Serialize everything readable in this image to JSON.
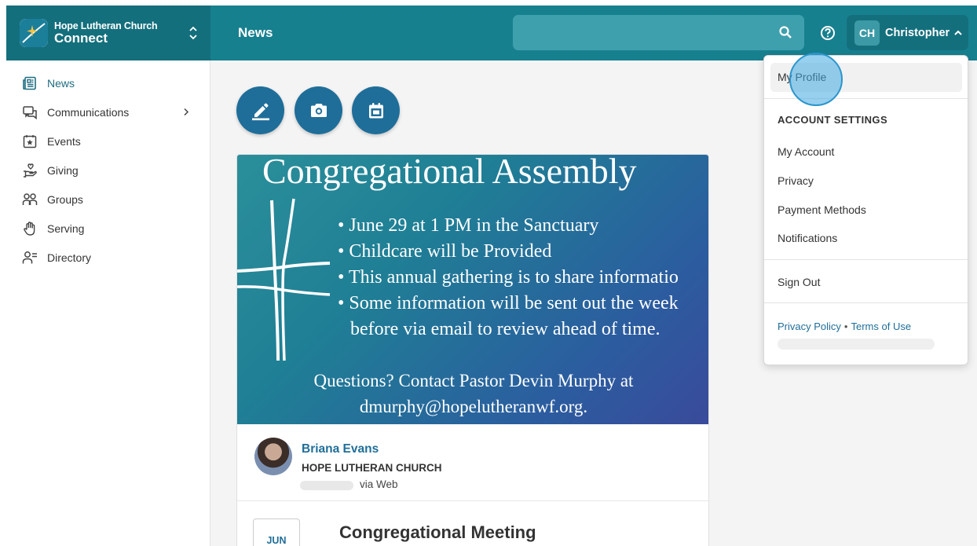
{
  "brand": {
    "church": "Hope Lutheran Church",
    "app": "Connect"
  },
  "header": {
    "page_title": "News",
    "search_placeholder": "",
    "user_initials": "CH",
    "user_name": "Christopher"
  },
  "sidebar": {
    "items": [
      {
        "label": "News",
        "icon": "newspaper-icon",
        "active": true
      },
      {
        "label": "Communications",
        "icon": "chat-bubbles-icon",
        "has_submenu": true
      },
      {
        "label": "Events",
        "icon": "calendar-star-icon"
      },
      {
        "label": "Giving",
        "icon": "hand-heart-icon"
      },
      {
        "label": "Groups",
        "icon": "people-icon"
      },
      {
        "label": "Serving",
        "icon": "hand-icon"
      },
      {
        "label": "Directory",
        "icon": "person-list-icon"
      }
    ]
  },
  "actions": [
    {
      "icon": "pencil-icon"
    },
    {
      "icon": "camera-icon"
    },
    {
      "icon": "calendar-icon"
    }
  ],
  "post": {
    "banner": {
      "title": "Congregational Assembly",
      "bullets": [
        "• June 29 at 1 PM in the Sanctuary",
        "• Childcare will be Provided",
        "• This annual gathering is to share informatio",
        "• Some information will be sent out the week",
        "before via email to review ahead of time."
      ],
      "question_line1": "Questions? Contact Pastor Devin Murphy at",
      "question_line2": "dmurphy@hopelutheranwf.org."
    },
    "author_name": "Briana Evans",
    "author_org": "HOPE LUTHERAN CHURCH",
    "via": "via Web",
    "event": {
      "month": "JUN",
      "title": "Congregational Meeting"
    }
  },
  "dropdown": {
    "my_profile": "My Profile",
    "section_heading": "ACCOUNT SETTINGS",
    "my_account": "My Account",
    "privacy": "Privacy",
    "payment_methods": "Payment Methods",
    "notifications": "Notifications",
    "sign_out": "Sign Out",
    "privacy_policy": "Privacy Policy",
    "terms_of_use": "Terms of Use",
    "separator": "•"
  },
  "colors": {
    "header": "#17808f",
    "brand_bg": "#146f7d",
    "accent": "#1f6e99"
  }
}
